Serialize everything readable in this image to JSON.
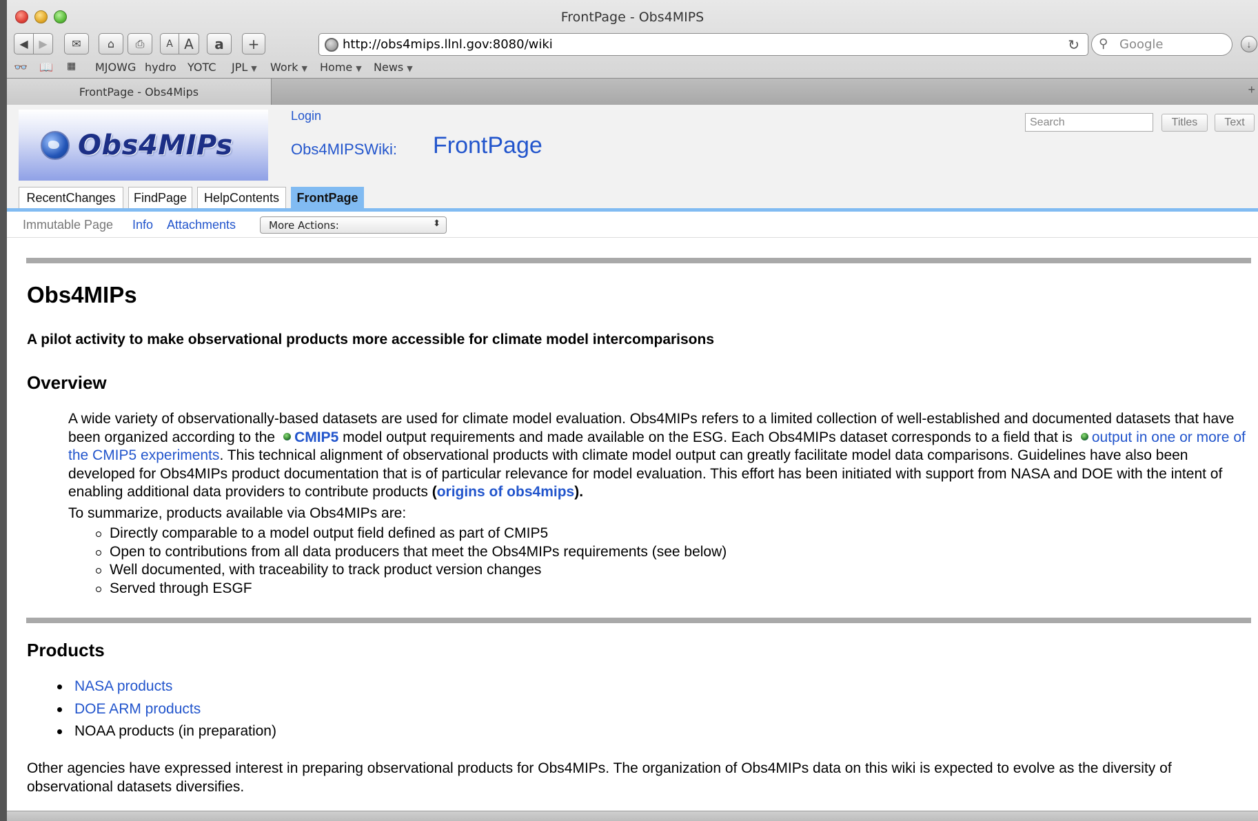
{
  "browser": {
    "window_title": "FrontPage - Obs4MIPS",
    "url": "http://obs4mips.llnl.gov:8080/wiki",
    "search_placeholder": "Google",
    "toolbar_font_small": "A",
    "toolbar_font_large": "A",
    "amazon_label": "a",
    "new_tab_label": "+",
    "bookmarks": [
      {
        "label": "MJOWG",
        "has_menu": false
      },
      {
        "label": "hydro",
        "has_menu": false
      },
      {
        "label": "YOTC",
        "has_menu": false
      },
      {
        "label": "JPL",
        "has_menu": true
      },
      {
        "label": "Work",
        "has_menu": true
      },
      {
        "label": "Home",
        "has_menu": true
      },
      {
        "label": "News",
        "has_menu": true
      }
    ],
    "tab_title": "FrontPage - Obs4Mips"
  },
  "wiki": {
    "logo_text": "Obs4MIPs",
    "login_label": "Login",
    "wiki_name": "Obs4MIPSWiki:",
    "page_title": "FrontPage",
    "search_placeholder": "Search",
    "titles_button": "Titles",
    "text_button": "Text",
    "nav_tabs": [
      {
        "label": "RecentChanges",
        "active": false
      },
      {
        "label": "FindPage",
        "active": false
      },
      {
        "label": "HelpContents",
        "active": false
      },
      {
        "label": "FrontPage",
        "active": true
      }
    ],
    "actions": {
      "immutable": "Immutable Page",
      "info": "Info",
      "attachments": "Attachments",
      "more_actions": "More Actions:"
    }
  },
  "content": {
    "heading": "Obs4MIPs",
    "subtitle": "A pilot activity to make observational products more accessible for climate model intercomparisons",
    "overview_heading": "Overview",
    "overview": {
      "t1": "A wide variety of observationally-based datasets are used for climate model evaluation. Obs4MIPs refers to a limited collection of well-established and documented datasets that have been organized according to the",
      "link_cmip5": "CMIP5",
      "t2": " model output requirements and made available on the ESG. Each Obs4MIPs dataset corresponds to a field that is",
      "link_output": "output in one or more of the CMIP5 experiments",
      "t3": ". This technical alignment of observational products with climate model output can greatly facilitate model data comparisons. Guidelines have also been developed for Obs4MIPs product documentation that is of particular relevance for model evaluation. This effort has been initiated with support from NASA and DOE with the intent of enabling additional data providers to contribute products ",
      "paren_open": "(",
      "link_origins": "origins of obs4mips",
      "paren_close": ")."
    },
    "summary_intro": "To summarize, products available via Obs4MIPs are:",
    "summary_items": [
      "Directly comparable to a model output field defined as part of CMIP5",
      "Open to contributions from all data producers that meet the Obs4MIPs requirements (see below)",
      "Well documented, with traceability to track product version changes",
      "Served through ESGF"
    ],
    "products_heading": "Products",
    "products": [
      {
        "label": "NASA products",
        "link": true
      },
      {
        "label": "DOE ARM products",
        "link": true
      },
      {
        "label": "NOAA products (in preparation)",
        "link": false
      }
    ],
    "closing": "Other agencies have expressed interest in preparing observational products for Obs4MIPs. The organization of Obs4MIPs data on this wiki is expected to evolve as the diversity of observational datasets diversifies."
  },
  "colors": {
    "link": "#2255cc",
    "tab_active": "#81bbf2",
    "rule": "#a9a9a9"
  }
}
